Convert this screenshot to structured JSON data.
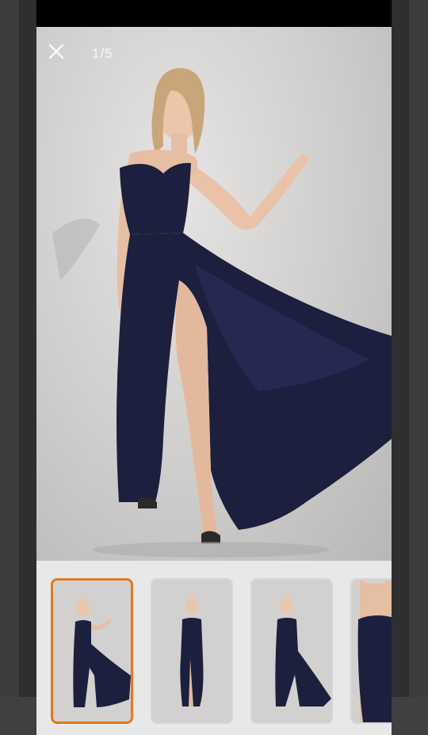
{
  "viewer": {
    "counter": "1/5",
    "close_icon": "close-icon",
    "accent_color": "#e07a1f",
    "dress_color": "#1c1f3d",
    "thumbnails": [
      {
        "selected": true
      },
      {
        "selected": false
      },
      {
        "selected": false
      },
      {
        "selected": false
      }
    ]
  }
}
